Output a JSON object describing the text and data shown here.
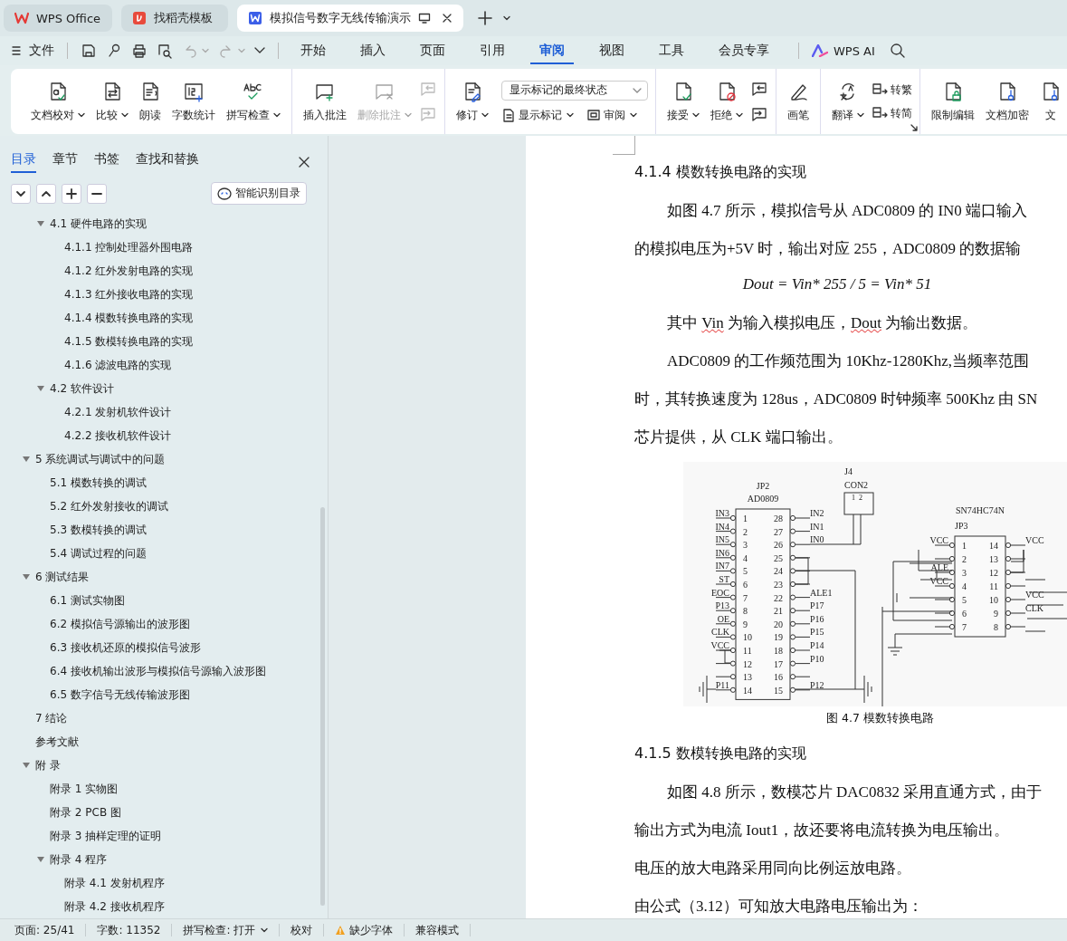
{
  "tabs": [
    {
      "title": "WPS Office",
      "selected": false
    },
    {
      "title": "找稻壳模板",
      "selected": false
    },
    {
      "title": "模拟信号数字无线传输演示",
      "selected": true
    }
  ],
  "menu": {
    "file": "文件",
    "items": [
      {
        "label": "开始",
        "selected": false
      },
      {
        "label": "插入",
        "selected": false
      },
      {
        "label": "页面",
        "selected": false
      },
      {
        "label": "引用",
        "selected": false
      },
      {
        "label": "审阅",
        "selected": true
      },
      {
        "label": "视图",
        "selected": false
      },
      {
        "label": "工具",
        "selected": false
      },
      {
        "label": "会员专享",
        "selected": false
      }
    ],
    "ai": "WPS AI"
  },
  "ribbon": {
    "groups": [
      {
        "items": [
          {
            "label": "文档校对",
            "caret": true,
            "disabled": false
          },
          {
            "label": "比较",
            "caret": true,
            "disabled": false
          },
          {
            "label": "朗读",
            "caret": false,
            "disabled": false
          },
          {
            "label": "字数统计",
            "caret": false,
            "disabled": false
          },
          {
            "label": "拼写检查",
            "caret": true,
            "disabled": false
          }
        ]
      },
      {
        "items": [
          {
            "label": "插入批注",
            "caret": false,
            "disabled": false
          },
          {
            "label": "删除批注",
            "caret": true,
            "disabled": true
          }
        ],
        "small_disabled": true
      },
      {
        "items": [
          {
            "label": "修订",
            "caret": true,
            "disabled": false
          }
        ],
        "dropdown": "显示标记的最终状态",
        "small": [
          {
            "label": "显示标记"
          },
          {
            "label": "审阅"
          }
        ]
      },
      {
        "items": [
          {
            "label": "接受",
            "caret": true,
            "disabled": false
          },
          {
            "label": "拒绝",
            "caret": true,
            "disabled": false
          }
        ],
        "small_disabled": false
      },
      {
        "items": [
          {
            "label": "画笔",
            "caret": false,
            "disabled": false
          }
        ]
      },
      {
        "items": [
          {
            "label": "翻译",
            "caret": true,
            "disabled": false
          }
        ],
        "convert": [
          {
            "label": "转繁"
          },
          {
            "label": "转简"
          }
        ]
      },
      {
        "items": [
          {
            "label": "限制编辑",
            "caret": false,
            "disabled": false
          },
          {
            "label": "文档加密",
            "caret": false,
            "disabled": false
          },
          {
            "label": "文",
            "caret": false,
            "disabled": false
          }
        ]
      }
    ]
  },
  "sidebar": {
    "tabs": [
      {
        "label": "目录",
        "selected": true
      },
      {
        "label": "章节",
        "selected": false
      },
      {
        "label": "书签",
        "selected": false
      },
      {
        "label": "查找和替换",
        "selected": false
      }
    ],
    "smart_button": "智能识别目录",
    "toc": [
      {
        "children": [
          {
            "label": "4.1 硬件电路的实现",
            "expanded": true,
            "children": [
              {
                "label": "4.1.1 控制处理器外围电路"
              },
              {
                "label": "4.1.2 红外发射电路的实现"
              },
              {
                "label": "4.1.3 红外接收电路的实现"
              },
              {
                "label": "4.1.4 模数转换电路的实现"
              },
              {
                "label": "4.1.5 数模转换电路的实现"
              },
              {
                "label": "4.1.6 滤波电路的实现"
              }
            ]
          },
          {
            "label": "4.2 软件设计",
            "expanded": true,
            "children": [
              {
                "label": "4.2.1 发射机软件设计"
              },
              {
                "label": "4.2.2 接收机软件设计"
              }
            ]
          }
        ]
      },
      {
        "label": "5 系统调试与调试中的问题",
        "expanded": true,
        "children": [
          {
            "label": "5.1 模数转换的调试"
          },
          {
            "label": "5.2 红外发射接收的调试"
          },
          {
            "label": "5.3 数模转换的调试"
          },
          {
            "label": "5.4 调试过程的问题"
          }
        ]
      },
      {
        "label": "6 测试结果",
        "expanded": true,
        "children": [
          {
            "label": "6.1 测试实物图"
          },
          {
            "label": "6.2 模拟信号源输出的波形图"
          },
          {
            "label": "6.3 接收机还原的模拟信号波形"
          },
          {
            "label": "6.4 接收机输出波形与模拟信号源输入波形图"
          },
          {
            "label": "6.5 数字信号无线传输波形图"
          }
        ]
      },
      {
        "label": "7 结论"
      },
      {
        "label": "参考文献"
      },
      {
        "label": "附 录",
        "expanded": true,
        "children": [
          {
            "label": "附录 1 实物图"
          },
          {
            "label": "附录 2 PCB 图"
          },
          {
            "label": "附录 3 抽样定理的证明"
          },
          {
            "label": "附录 4 程序",
            "expanded": true,
            "children": [
              {
                "label": "附录 4.1 发射机程序"
              },
              {
                "label": "附录 4.2 接收机程序"
              }
            ]
          }
        ]
      }
    ]
  },
  "document": {
    "blocks": [
      {
        "kind": "heading",
        "text": "4.1.4  模数转换电路的实现"
      },
      {
        "kind": "first_line",
        "runs": [
          {
            "text": "如图 4.7 所示，模拟信号从 ADC0809 的 IN0 端口输入"
          }
        ]
      },
      {
        "kind": "line",
        "runs": [
          {
            "text": "的模拟电压为+5V 时，输出对应 255，ADC0809 的数据输"
          }
        ]
      },
      {
        "kind": "formula",
        "text": "Dout = Vin* 255 / 5 = Vin* 51"
      },
      {
        "kind": "first_line",
        "runs": [
          {
            "text": "其中 "
          },
          {
            "text": "Vin",
            "spell_error": true
          },
          {
            "text": " 为输入模拟电压，"
          },
          {
            "text": "Dout",
            "spell_error": true
          },
          {
            "text": " 为输出数据。"
          }
        ]
      },
      {
        "kind": "first_line",
        "runs": [
          {
            "text": "ADC0809 的工作频范围为 10Khz-1280Khz,当频率范围"
          }
        ]
      },
      {
        "kind": "line",
        "runs": [
          {
            "text": "时，其转换速度为 128us，ADC0809 时钟频率 500Khz 由 SN"
          }
        ]
      },
      {
        "kind": "line",
        "runs": [
          {
            "text": "芯片提供，从 CLK 端口输出。"
          }
        ]
      },
      {
        "kind": "figure",
        "caption": "图 4.7  模数转换电路"
      },
      {
        "kind": "heading",
        "text": "4.1.5 数模转换电路的实现"
      },
      {
        "kind": "first_line",
        "runs": [
          {
            "text": "如图 4.8 所示，数模芯片 DAC0832 采用直通方式，由于"
          }
        ]
      },
      {
        "kind": "line",
        "runs": [
          {
            "text": "输出方式为电流 Iout1，故还要将电流转换为电压输出。"
          }
        ]
      },
      {
        "kind": "line",
        "runs": [
          {
            "text": "电压的放大电路采用同向比例运放电路。"
          }
        ]
      },
      {
        "kind": "line",
        "runs": [
          {
            "text": "由公式（3.12）可知放大电路电压输出为："
          }
        ]
      }
    ]
  },
  "circuit": {
    "chips": [
      {
        "ref": "JP2",
        "part": "AD0809",
        "left": [
          {
            "n": "1",
            "net": "IN3"
          },
          {
            "n": "2",
            "net": "IN4"
          },
          {
            "n": "3",
            "net": "IN5"
          },
          {
            "n": "4",
            "net": "IN6"
          },
          {
            "n": "5",
            "net": "IN7"
          },
          {
            "n": "6",
            "net": "ST"
          },
          {
            "n": "7",
            "net": "EOC"
          },
          {
            "n": "8",
            "net": "P13"
          },
          {
            "n": "9",
            "net": "OE"
          },
          {
            "n": "10",
            "net": "CLK"
          },
          {
            "n": "11",
            "net": "VCC"
          },
          {
            "n": "12"
          },
          {
            "n": "13"
          },
          {
            "n": "14",
            "net": "P11"
          }
        ],
        "right": [
          {
            "n": "28",
            "net": "IN2"
          },
          {
            "n": "27",
            "net": "IN1"
          },
          {
            "n": "26",
            "net": "IN0"
          },
          {
            "n": "25"
          },
          {
            "n": "24"
          },
          {
            "n": "23"
          },
          {
            "n": "22",
            "net": "ALE1"
          },
          {
            "n": "21",
            "net": "P17"
          },
          {
            "n": "20",
            "net": "P16"
          },
          {
            "n": "19",
            "net": "P15"
          },
          {
            "n": "18",
            "net": "P14"
          },
          {
            "n": "17",
            "net": "P10"
          },
          {
            "n": "16"
          },
          {
            "n": "15",
            "net": "P12"
          }
        ]
      },
      {
        "ref": "JP3",
        "part": "SN74HC74N",
        "left": [
          {
            "n": "1",
            "net": "VCC"
          },
          {
            "n": "2"
          },
          {
            "n": "3",
            "net": "ALE"
          },
          {
            "n": "4",
            "net": "VCC"
          },
          {
            "n": "5"
          },
          {
            "n": "6"
          },
          {
            "n": "7"
          }
        ],
        "right": [
          {
            "n": "14",
            "net": "VCC"
          },
          {
            "n": "13"
          },
          {
            "n": "12"
          },
          {
            "n": "11"
          },
          {
            "n": "10",
            "net": "VCC"
          },
          {
            "n": "9",
            "net": "CLK"
          },
          {
            "n": "8"
          }
        ]
      }
    ],
    "connector": {
      "ref": "J4",
      "part": "CON2",
      "pins": [
        "1",
        "2"
      ]
    }
  },
  "status_bar": [
    {
      "text": "页面: 25/41",
      "kind": "plain"
    },
    {
      "text": "字数: 11352",
      "kind": "plain"
    },
    {
      "text": "拼写检查: 打开",
      "kind": "menu"
    },
    {
      "text": "校对",
      "kind": "plain"
    },
    {
      "text": "缺少字体",
      "kind": "warning"
    },
    {
      "text": "兼容模式",
      "kind": "plain"
    }
  ]
}
